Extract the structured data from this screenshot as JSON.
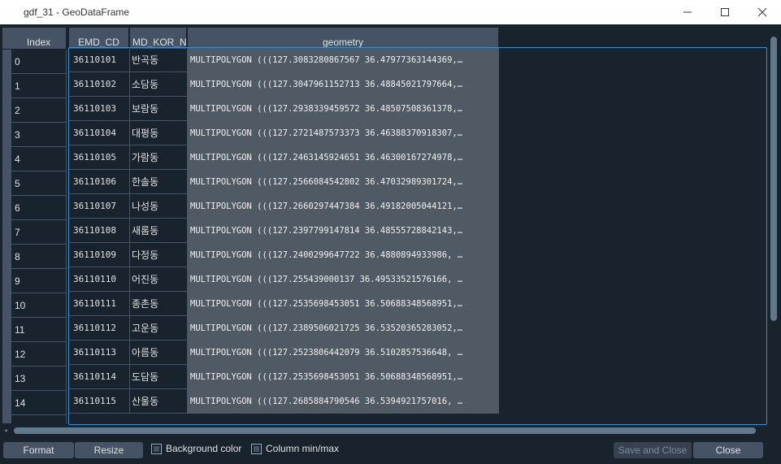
{
  "window": {
    "title": "gdf_31 - GeoDataFrame",
    "minimize_icon": "minimize-icon",
    "maximize_icon": "maximize-icon",
    "close_icon": "close-icon"
  },
  "table": {
    "headers": [
      "Index",
      "EMD_CD",
      "MD_KOR_NI",
      "geometry"
    ],
    "rows": [
      {
        "index": "0",
        "emd_cd": "36110101",
        "kor": "반곡동",
        "geometry": "MULTIPOLYGON (((127.3083280867567 36.47977363144369,…"
      },
      {
        "index": "1",
        "emd_cd": "36110102",
        "kor": "소담동",
        "geometry": "MULTIPOLYGON (((127.3047961152713 36.48845021797664,…"
      },
      {
        "index": "2",
        "emd_cd": "36110103",
        "kor": "보람동",
        "geometry": "MULTIPOLYGON (((127.2938339459572 36.48507508361378,…"
      },
      {
        "index": "3",
        "emd_cd": "36110104",
        "kor": "대평동",
        "geometry": "MULTIPOLYGON (((127.2721487573373 36.46388370918307,…"
      },
      {
        "index": "4",
        "emd_cd": "36110105",
        "kor": "가람동",
        "geometry": "MULTIPOLYGON (((127.2463145924651 36.46300167274978,…"
      },
      {
        "index": "5",
        "emd_cd": "36110106",
        "kor": "한솔동",
        "geometry": "MULTIPOLYGON (((127.2566084542802 36.47032989301724,…"
      },
      {
        "index": "6",
        "emd_cd": "36110107",
        "kor": "나성동",
        "geometry": "MULTIPOLYGON (((127.2660297447384 36.49182005044121,…"
      },
      {
        "index": "7",
        "emd_cd": "36110108",
        "kor": "새롬동",
        "geometry": "MULTIPOLYGON (((127.2397799147814 36.48555728842143,…"
      },
      {
        "index": "8",
        "emd_cd": "36110109",
        "kor": "다정동",
        "geometry": "MULTIPOLYGON (((127.2400299647722 36.4880894933986, …"
      },
      {
        "index": "9",
        "emd_cd": "36110110",
        "kor": "어진동",
        "geometry": "MULTIPOLYGON (((127.255439000137 36.49533521576166, …"
      },
      {
        "index": "10",
        "emd_cd": "36110111",
        "kor": "종촌동",
        "geometry": "MULTIPOLYGON (((127.2535698453051 36.50688348568951,…"
      },
      {
        "index": "11",
        "emd_cd": "36110112",
        "kor": "고운동",
        "geometry": "MULTIPOLYGON (((127.2389506021725 36.53520365283052,…"
      },
      {
        "index": "12",
        "emd_cd": "36110113",
        "kor": "아름동",
        "geometry": "MULTIPOLYGON (((127.2523806442079 36.5102857536648, …"
      },
      {
        "index": "13",
        "emd_cd": "36110114",
        "kor": "도담동",
        "geometry": "MULTIPOLYGON (((127.2535698453051 36.50688348568951,…"
      },
      {
        "index": "14",
        "emd_cd": "36110115",
        "kor": "산울동",
        "geometry": "MULTIPOLYGON (((127.2685884790546 36.5394921757016, …"
      }
    ]
  },
  "toolbar": {
    "format_label": "Format",
    "resize_label": "Resize",
    "bg_color_label": "Background color",
    "col_minmax_label": "Column min/max",
    "save_close_label": "Save and Close",
    "close_label": "Close"
  },
  "colors": {
    "background": "#19232d",
    "header": "#455364",
    "geometry_cell": "#505a64",
    "selection_border": "#3a8fd0"
  }
}
